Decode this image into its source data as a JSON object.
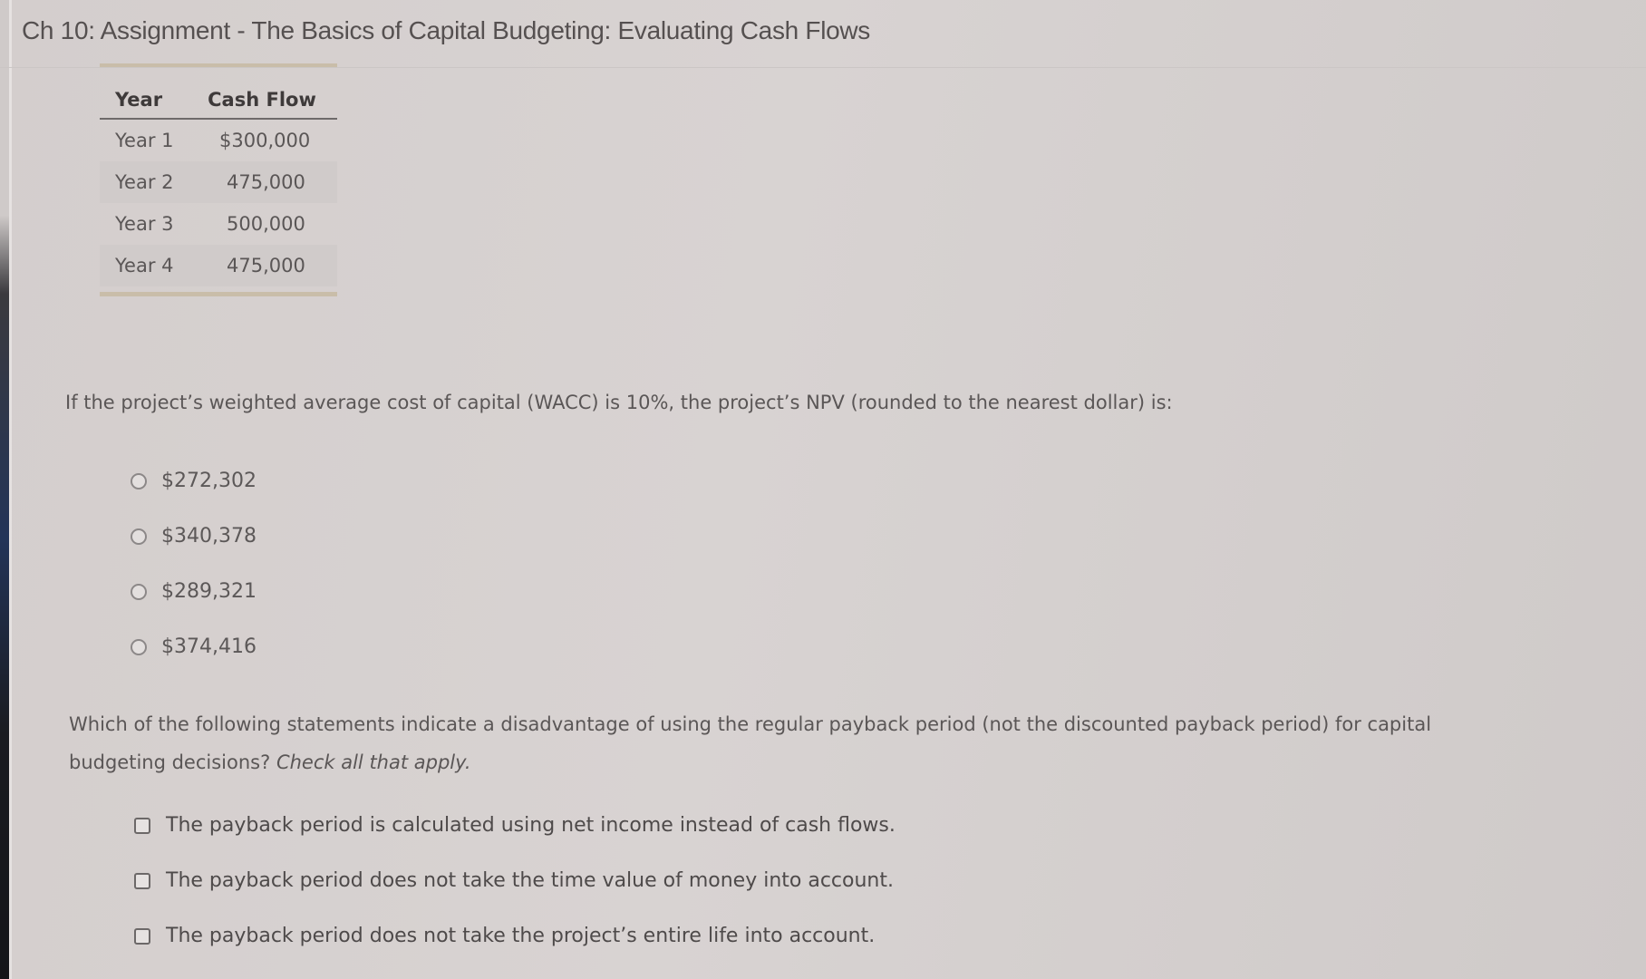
{
  "page": {
    "title": "Ch 10: Assignment - The Basics of Capital Budgeting: Evaluating Cash Flows"
  },
  "cash_flow_table": {
    "headers": [
      "Year",
      "Cash Flow"
    ],
    "rows": [
      {
        "year": "Year 1",
        "cash_flow": "$300,000"
      },
      {
        "year": "Year 2",
        "cash_flow": "475,000"
      },
      {
        "year": "Year 3",
        "cash_flow": "500,000"
      },
      {
        "year": "Year 4",
        "cash_flow": "475,000"
      }
    ]
  },
  "question1": {
    "prompt": "If the project’s weighted average cost of capital (WACC) is 10%, the project’s NPV (rounded to the nearest dollar) is:",
    "options": [
      {
        "label": "$272,302",
        "selected": false
      },
      {
        "label": "$340,378",
        "selected": false
      },
      {
        "label": "$289,321",
        "selected": false
      },
      {
        "label": "$374,416",
        "selected": false
      }
    ]
  },
  "question2": {
    "prompt": "Which of the following statements indicate a disadvantage of using the regular payback period (not the discounted payback period) for capital budgeting decisions?",
    "instruction": "Check all that apply.",
    "options": [
      {
        "label": "The payback period is calculated using net income instead of cash flows.",
        "checked": false
      },
      {
        "label": "The payback period does not take the time value of money into account.",
        "checked": false
      },
      {
        "label": "The payback period does not take the project’s entire life into account.",
        "checked": false
      }
    ]
  }
}
